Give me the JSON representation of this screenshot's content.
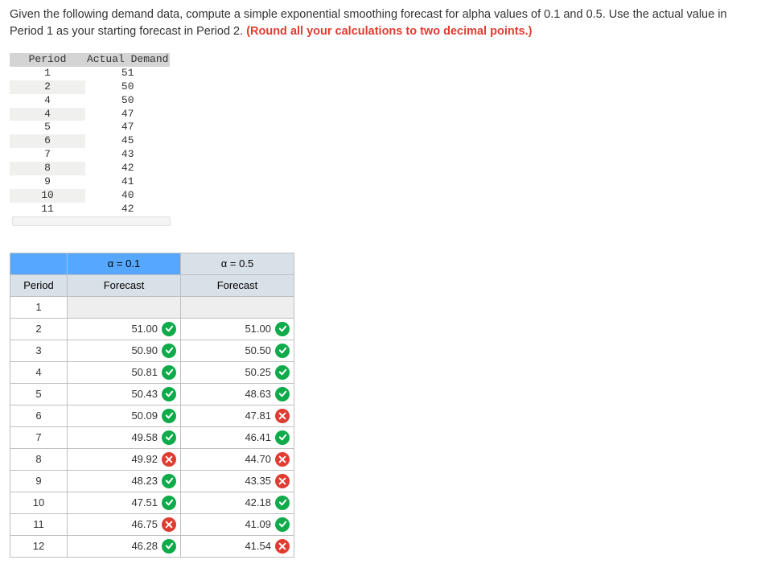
{
  "question": {
    "part1": "Given the following demand data, compute a simple exponential smoothing forecast for alpha values of 0.1 and 0.5. Use the actual value in Period 1 as your starting forecast in Period 2. ",
    "bold_red": "(Round all your calculations to two decimal points.)"
  },
  "data_table": {
    "head_period": "Period",
    "head_demand": "Actual Demand",
    "rows": [
      {
        "p": "1",
        "d": "51"
      },
      {
        "p": "2",
        "d": "50"
      },
      {
        "p": "4",
        "d": "50"
      },
      {
        "p": "4",
        "d": "47"
      },
      {
        "p": "5",
        "d": "47"
      },
      {
        "p": "6",
        "d": "45"
      },
      {
        "p": "7",
        "d": "43"
      },
      {
        "p": "8",
        "d": "42"
      },
      {
        "p": "9",
        "d": "41"
      },
      {
        "p": "10",
        "d": "40"
      },
      {
        "p": "11",
        "d": "42"
      }
    ]
  },
  "ans_table": {
    "alpha1_label": "α = 0.1",
    "alpha2_label": "α = 0.5",
    "period_label": "Period",
    "forecast_label": "Forecast",
    "rows": [
      {
        "period": "1",
        "a1": "",
        "s1": "",
        "a2": "",
        "s2": ""
      },
      {
        "period": "2",
        "a1": "51.00",
        "s1": "correct",
        "a2": "51.00",
        "s2": "correct"
      },
      {
        "period": "3",
        "a1": "50.90",
        "s1": "correct",
        "a2": "50.50",
        "s2": "correct"
      },
      {
        "period": "4",
        "a1": "50.81",
        "s1": "correct",
        "a2": "50.25",
        "s2": "correct"
      },
      {
        "period": "5",
        "a1": "50.43",
        "s1": "correct",
        "a2": "48.63",
        "s2": "correct"
      },
      {
        "period": "6",
        "a1": "50.09",
        "s1": "correct",
        "a2": "47.81",
        "s2": "wrong"
      },
      {
        "period": "7",
        "a1": "49.58",
        "s1": "correct",
        "a2": "46.41",
        "s2": "correct"
      },
      {
        "period": "8",
        "a1": "49.92",
        "s1": "wrong",
        "a2": "44.70",
        "s2": "wrong"
      },
      {
        "period": "9",
        "a1": "48.23",
        "s1": "correct",
        "a2": "43.35",
        "s2": "wrong"
      },
      {
        "period": "10",
        "a1": "47.51",
        "s1": "correct",
        "a2": "42.18",
        "s2": "correct"
      },
      {
        "period": "11",
        "a1": "46.75",
        "s1": "wrong",
        "a2": "41.09",
        "s2": "correct"
      },
      {
        "period": "12",
        "a1": "46.28",
        "s1": "correct",
        "a2": "41.54",
        "s2": "wrong"
      }
    ]
  }
}
